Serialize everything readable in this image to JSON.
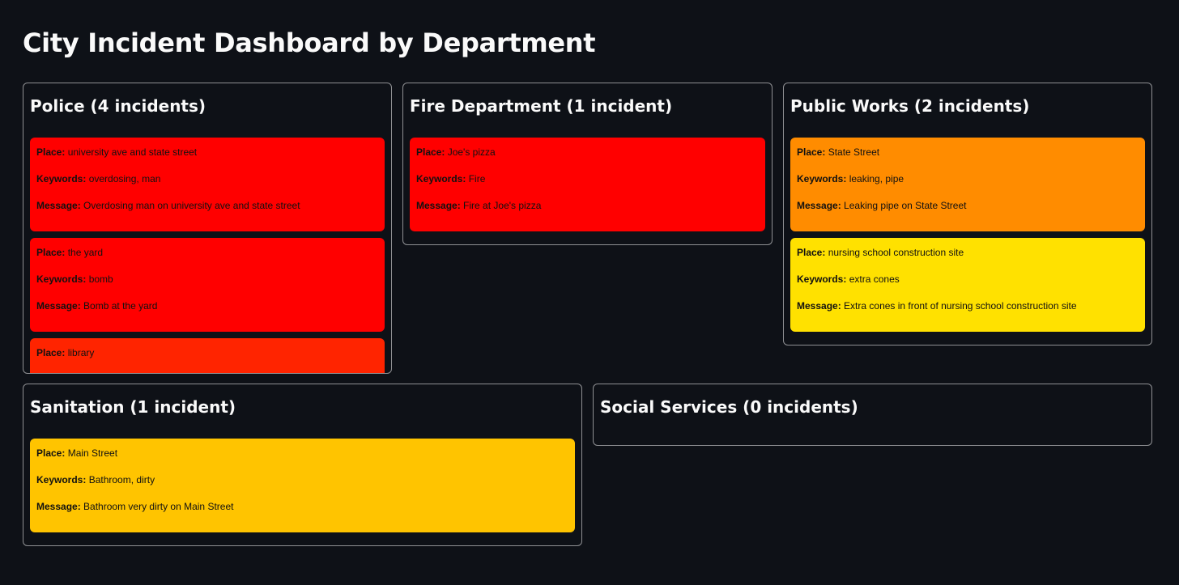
{
  "title": "City Incident Dashboard by Department",
  "labels": {
    "place": "Place:",
    "keywords": "Keywords:",
    "message": "Message:"
  },
  "departments": [
    {
      "heading": "Police (4 incidents)",
      "incidents": [
        {
          "place": "university ave and state street",
          "keywords": "overdosing, man",
          "message": "Overdosing man on university ave and state street",
          "color": "#ff0000"
        },
        {
          "place": "the yard",
          "keywords": "bomb",
          "message": "Bomb at the yard",
          "color": "#ff0000"
        },
        {
          "place": "library",
          "keywords": "",
          "message": "",
          "color": "#ff2400"
        }
      ]
    },
    {
      "heading": "Fire Department (1 incident)",
      "incidents": [
        {
          "place": "Joe's pizza",
          "keywords": "Fire",
          "message": "Fire at Joe's pizza",
          "color": "#ff0000"
        }
      ]
    },
    {
      "heading": "Public Works (2 incidents)",
      "incidents": [
        {
          "place": "State Street",
          "keywords": "leaking, pipe",
          "message": "Leaking pipe on State Street",
          "color": "#ff8c00"
        },
        {
          "place": "nursing school construction site",
          "keywords": "extra cones",
          "message": "Extra cones in front of nursing school construction site",
          "color": "#ffe100"
        }
      ]
    },
    {
      "heading": "Sanitation (1 incident)",
      "incidents": [
        {
          "place": "Main Street",
          "keywords": "Bathroom, dirty",
          "message": "Bathroom very dirty on Main Street",
          "color": "#ffc400"
        }
      ]
    },
    {
      "heading": "Social Services (0 incidents)",
      "incidents": []
    }
  ]
}
